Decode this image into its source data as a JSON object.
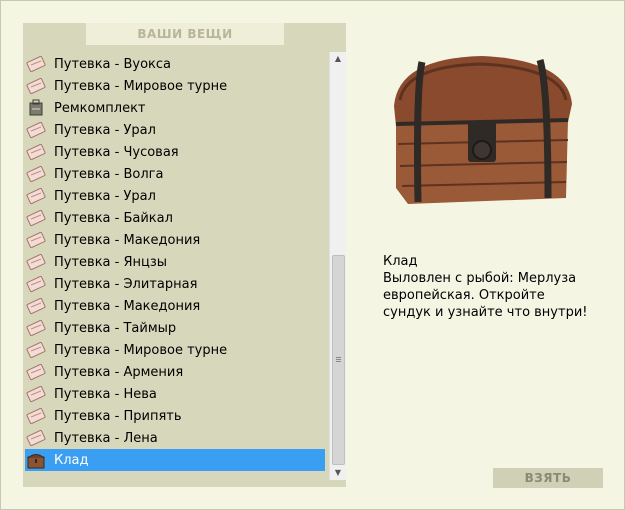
{
  "panel": {
    "header": "ВАШИ ВЕЩИ"
  },
  "items": [
    {
      "label": "Путевка - Вуокса",
      "icon": "ticket-icon"
    },
    {
      "label": "Путевка - Мировое турне",
      "icon": "ticket-icon"
    },
    {
      "label": "Ремкомплект",
      "icon": "repair-kit-icon"
    },
    {
      "label": "Путевка - Урал",
      "icon": "ticket-icon"
    },
    {
      "label": "Путевка - Чусовая",
      "icon": "ticket-icon"
    },
    {
      "label": "Путевка - Волга",
      "icon": "ticket-icon"
    },
    {
      "label": "Путевка - Урал",
      "icon": "ticket-icon"
    },
    {
      "label": "Путевка - Байкал",
      "icon": "ticket-icon"
    },
    {
      "label": "Путевка - Македония",
      "icon": "ticket-icon"
    },
    {
      "label": "Путевка - Янцзы",
      "icon": "ticket-icon"
    },
    {
      "label": "Путевка - Элитарная",
      "icon": "ticket-icon"
    },
    {
      "label": "Путевка - Македония",
      "icon": "ticket-icon"
    },
    {
      "label": "Путевка - Таймыр",
      "icon": "ticket-icon"
    },
    {
      "label": "Путевка - Мировое турне",
      "icon": "ticket-icon"
    },
    {
      "label": "Путевка - Армения",
      "icon": "ticket-icon"
    },
    {
      "label": "Путевка - Нева",
      "icon": "ticket-icon"
    },
    {
      "label": "Путевка - Припять",
      "icon": "ticket-icon"
    },
    {
      "label": "Путевка - Лена",
      "icon": "ticket-icon"
    },
    {
      "label": "Клад",
      "icon": "chest-icon",
      "selected": true
    }
  ],
  "detail": {
    "image": "treasure-chest-image",
    "title": "Клад",
    "description": "Выловлен с рыбой: Мерлуза европейская. Откройте сундук и узнайте что внутри!"
  },
  "actions": {
    "take_label": "ВЗЯТЬ"
  },
  "colors": {
    "selection": "#3a9ff2",
    "panel": "#d7d7bc",
    "background": "#f5f5e4"
  }
}
